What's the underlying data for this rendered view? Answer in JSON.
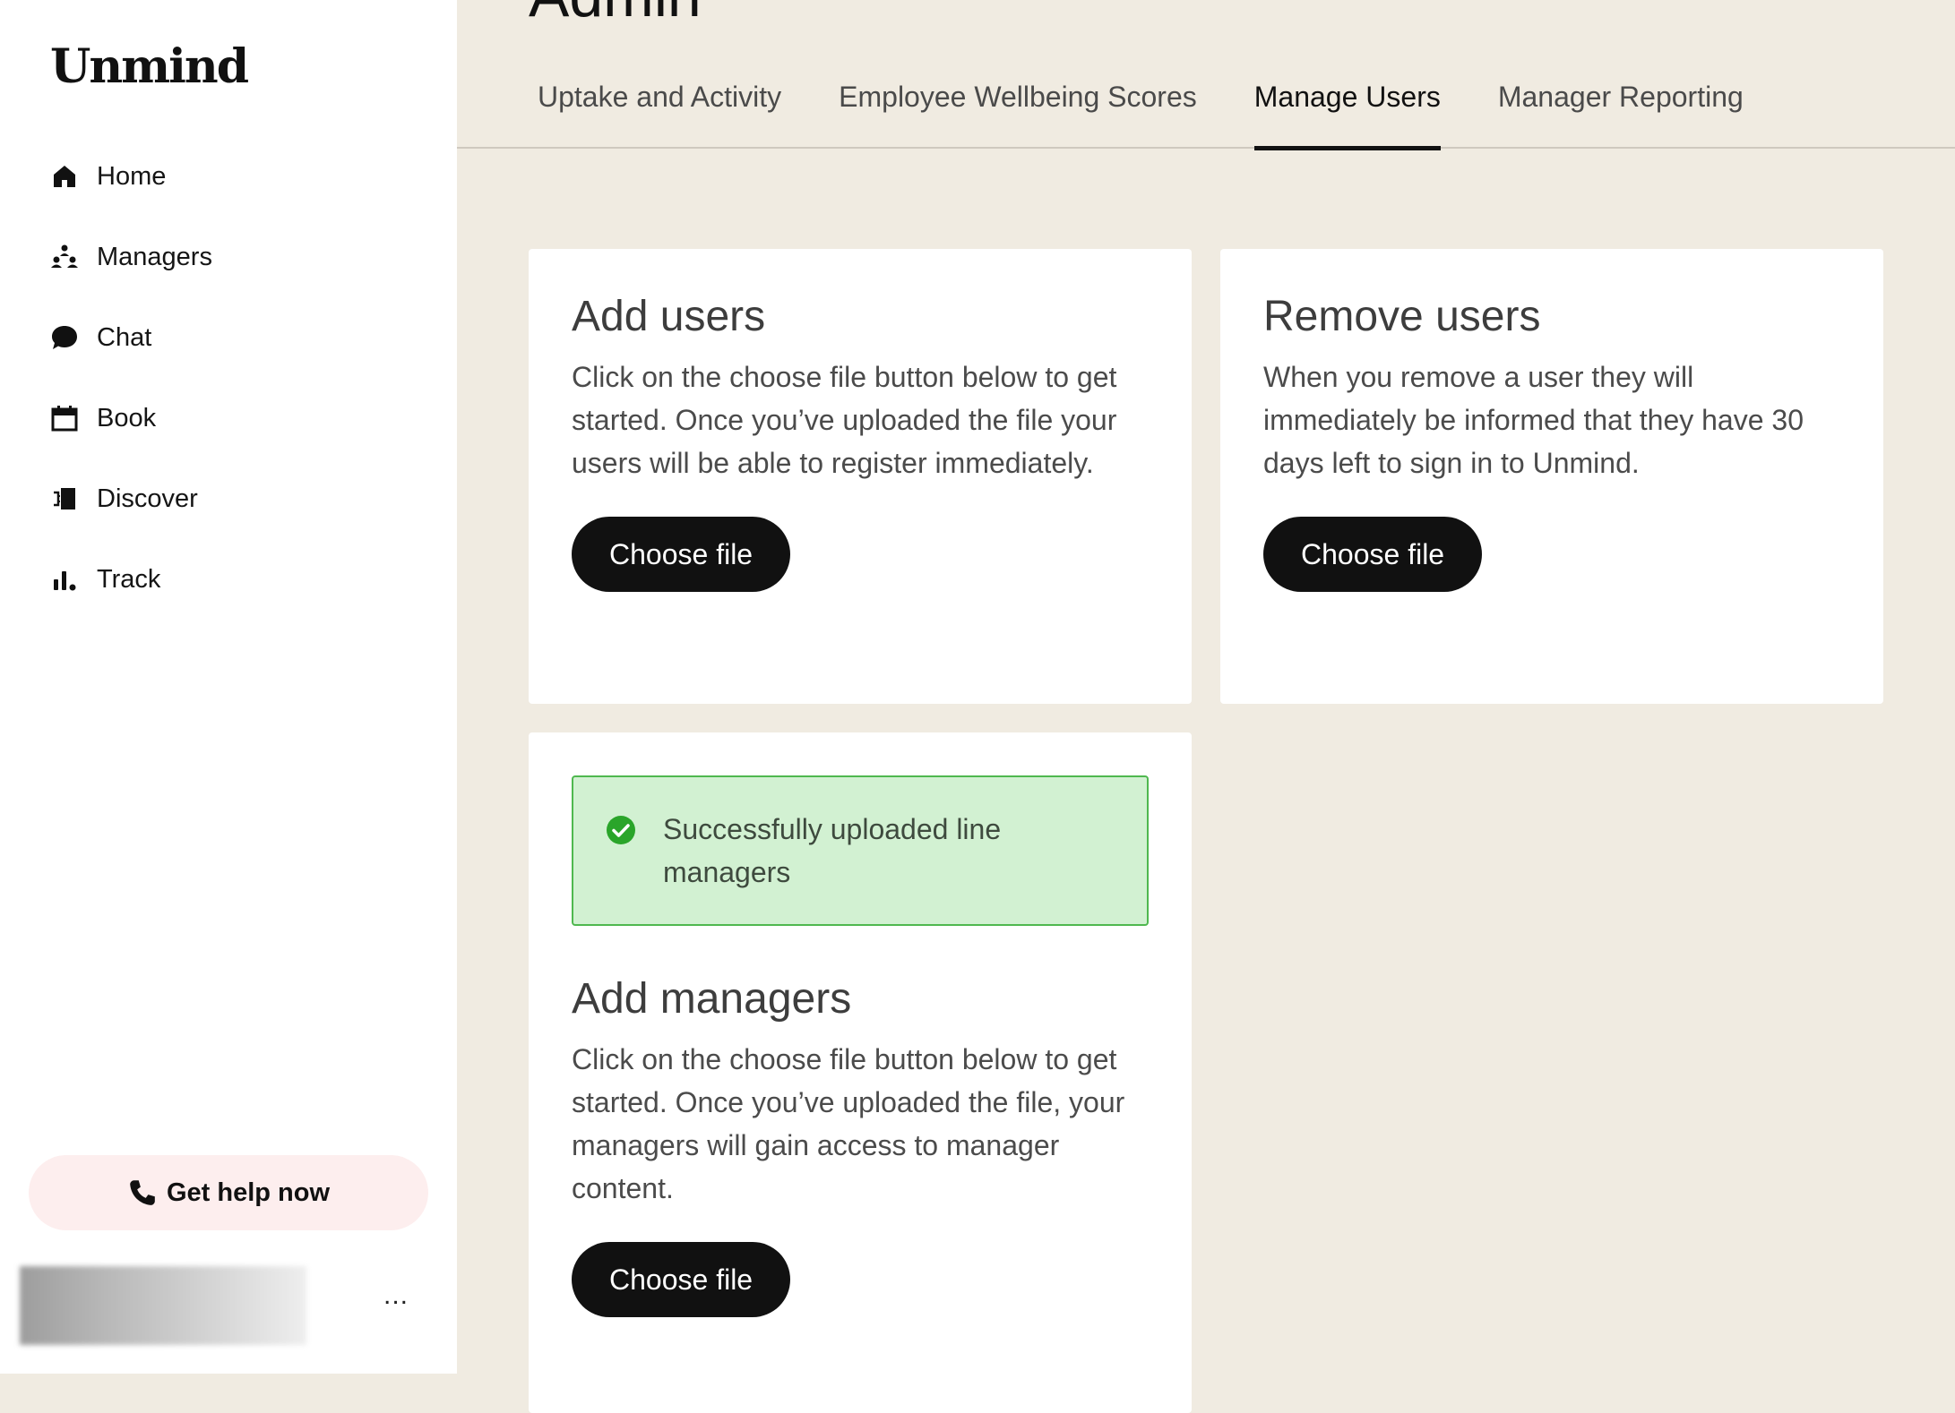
{
  "app": {
    "logo": "Unmind"
  },
  "sidebar": {
    "items": [
      {
        "label": "Home",
        "icon": "home-icon"
      },
      {
        "label": "Managers",
        "icon": "managers-icon"
      },
      {
        "label": "Chat",
        "icon": "chat-icon"
      },
      {
        "label": "Book",
        "icon": "calendar-icon"
      },
      {
        "label": "Discover",
        "icon": "discover-icon"
      },
      {
        "label": "Track",
        "icon": "bar-chart-icon"
      }
    ],
    "help_label": "Get help now",
    "more_label": "..."
  },
  "main": {
    "title": "Admin",
    "tabs": [
      {
        "label": "Uptake and Activity",
        "active": false
      },
      {
        "label": "Employee Wellbeing Scores",
        "active": false
      },
      {
        "label": "Manage Users",
        "active": true
      },
      {
        "label": "Manager Reporting",
        "active": false
      }
    ],
    "add_users": {
      "title": "Add users",
      "description": "Click on the choose file button below to get started. Once you’ve uploaded the file your users will be able to register immediately.",
      "button": "Choose file"
    },
    "remove_users": {
      "title": "Remove users",
      "description": "When you remove a user they will immediately be informed that they have 30 days left to sign in to Unmind.",
      "button": "Choose file"
    },
    "add_managers": {
      "alert": "Successfully uploaded line managers",
      "title": "Add managers",
      "description": "Click on the choose file button below to get started. Once you’ve uploaded the file, your managers will gain access to manager content.",
      "button": "Choose file"
    }
  },
  "colors": {
    "background": "#f0ebe1",
    "button": "#111111",
    "success_bg": "#d2f1d2",
    "success_border": "#4fb84f",
    "help_bg": "#fdeeee"
  }
}
